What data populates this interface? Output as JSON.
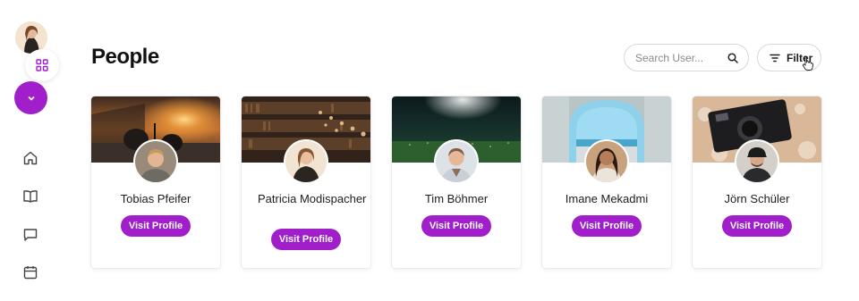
{
  "page": {
    "title": "People"
  },
  "search": {
    "placeholder": "Search User..."
  },
  "filter": {
    "label": "Filter"
  },
  "sidebar": {
    "nav_icons": [
      "home-icon",
      "book-icon",
      "chat-icon",
      "calendar-icon"
    ],
    "accent": "#a11ecb"
  },
  "people": [
    {
      "name": "Tobias Pfeifer",
      "button": "Visit Profile"
    },
    {
      "name": "Patricia Modispacher",
      "button": "Visit Profile"
    },
    {
      "name": "Tim Böhmer",
      "button": "Visit Profile"
    },
    {
      "name": "Imane Mekadmi",
      "button": "Visit Profile"
    },
    {
      "name": "Jörn Schüler",
      "button": "Visit Profile"
    }
  ]
}
